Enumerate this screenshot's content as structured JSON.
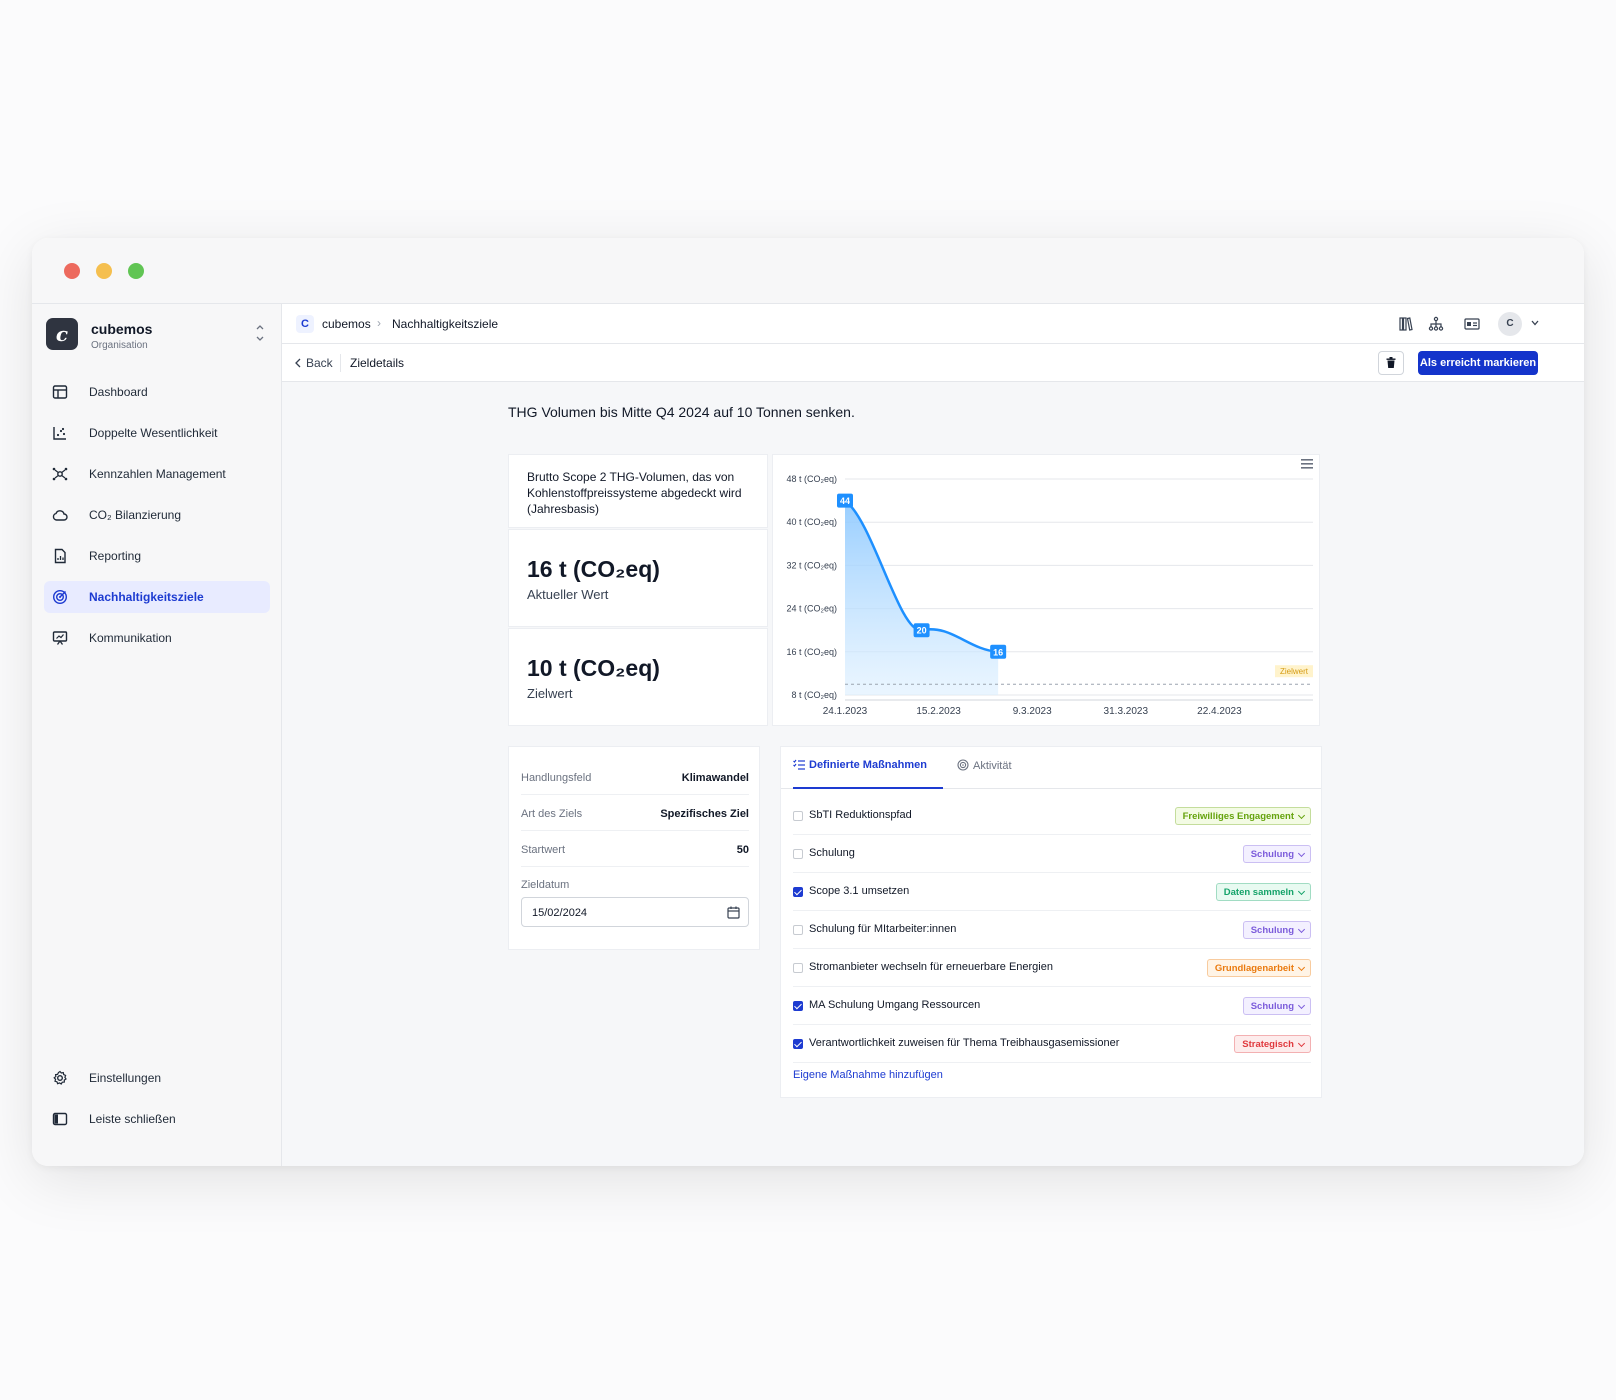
{
  "org": {
    "name": "cubemos",
    "subtitle": "Organisation",
    "logo_letter": "c"
  },
  "nav": {
    "items": [
      {
        "label": "Dashboard",
        "icon": "layout-icon"
      },
      {
        "label": "Doppelte Wesentlichkeit",
        "icon": "scatter-chart-icon"
      },
      {
        "label": "Kennzahlen Management",
        "icon": "network-icon"
      },
      {
        "label": "CO₂ Bilanzierung",
        "icon": "cloud-icon"
      },
      {
        "label": "Reporting",
        "icon": "document-chart-icon"
      },
      {
        "label": "Nachhaltigkeitsziele",
        "icon": "target-icon",
        "active": true
      },
      {
        "label": "Kommunikation",
        "icon": "presentation-icon"
      }
    ],
    "bottom": [
      {
        "label": "Einstellungen",
        "icon": "gear-icon"
      },
      {
        "label": "Leiste schließen",
        "icon": "sidebar-collapse-icon"
      }
    ]
  },
  "breadcrumb": {
    "logo_letter": "C",
    "org": "cubemos",
    "separator": "›",
    "page": "Nachhaltigkeitsziele"
  },
  "user": {
    "initial": "C"
  },
  "subbar": {
    "back": "Back",
    "title": "Zieldetails",
    "primary_action": "Als erreicht markieren"
  },
  "goal": {
    "title": "THG Volumen bis Mitte Q4 2024 auf 10 Tonnen senken."
  },
  "kpi": {
    "description": "Brutto Scope 2 THG-Volumen, das von Kohlenstoffpreissysteme abgedeckt wird (Jahresbasis)",
    "current_value": "16 t (CO₂eq)",
    "current_label": "Aktueller Wert",
    "target_value": "10 t (CO₂eq)",
    "target_label": "Zielwert"
  },
  "chart_data": {
    "type": "area",
    "x": [
      "2023-01-24",
      "2023-02-11",
      "2023-03-01"
    ],
    "values": [
      44,
      20,
      16
    ],
    "data_labels": [
      "44",
      "20",
      "16"
    ],
    "target": 10,
    "target_label": "Zielwert",
    "y_ticks": [
      "8 t (CO₂eq)",
      "16 t (CO₂eq)",
      "24 t (CO₂eq)",
      "32 t (CO₂eq)",
      "40 t (CO₂eq)",
      "48 t (CO₂eq)"
    ],
    "x_ticks": [
      "24.1.2023",
      "15.2.2023",
      "9.3.2023",
      "31.3.2023",
      "22.4.2023"
    ],
    "ylim": [
      8,
      48
    ],
    "xlim": [
      "2023-01-24",
      "2023-05-14"
    ],
    "grid": true,
    "color": "#1e90ff"
  },
  "details": {
    "rows": [
      {
        "key": "Handlungsfeld",
        "value": "Klimawandel"
      },
      {
        "key": "Art des Ziels",
        "value": "Spezifisches Ziel"
      },
      {
        "key": "Startwert",
        "value": "50"
      }
    ],
    "date_label": "Zieldatum",
    "date_value": "15/02/2024"
  },
  "measures": {
    "tab_active": "Definierte Maßnahmen",
    "tab_inactive": "Aktivität",
    "items": [
      {
        "label": "SbTI Reduktionspfad",
        "checked": false,
        "tag": "Freiwilliges Engagement",
        "tag_color": "#65a30d",
        "tag_bg": "#f3fbe4"
      },
      {
        "label": "Schulung",
        "checked": false,
        "tag": "Schulung",
        "tag_color": "#7c5cdb",
        "tag_bg": "#f3f0ff"
      },
      {
        "label": "Scope 3.1 umsetzen",
        "checked": true,
        "tag": "Daten sammeln",
        "tag_color": "#15a36a",
        "tag_bg": "#e8faf1"
      },
      {
        "label": "Schulung für MItarbeiter:innen",
        "checked": false,
        "tag": "Schulung",
        "tag_color": "#7c5cdb",
        "tag_bg": "#f3f0ff"
      },
      {
        "label": "Stromanbieter wechseln für erneuerbare Energien",
        "checked": false,
        "tag": "Grundlagenarbeit",
        "tag_color": "#ea7a0e",
        "tag_bg": "#fff4e6"
      },
      {
        "label": "MA Schulung Umgang Ressourcen",
        "checked": true,
        "tag": "Schulung",
        "tag_color": "#7c5cdb",
        "tag_bg": "#f3f0ff"
      },
      {
        "label": "Verantwortlichkeit zuweisen für Thema Treibhausgasemissioner",
        "checked": true,
        "tag": "Strategisch",
        "tag_color": "#e0393e",
        "tag_bg": "#fdecec"
      }
    ],
    "add_link": "Eigene Maßnahme hinzufügen"
  }
}
